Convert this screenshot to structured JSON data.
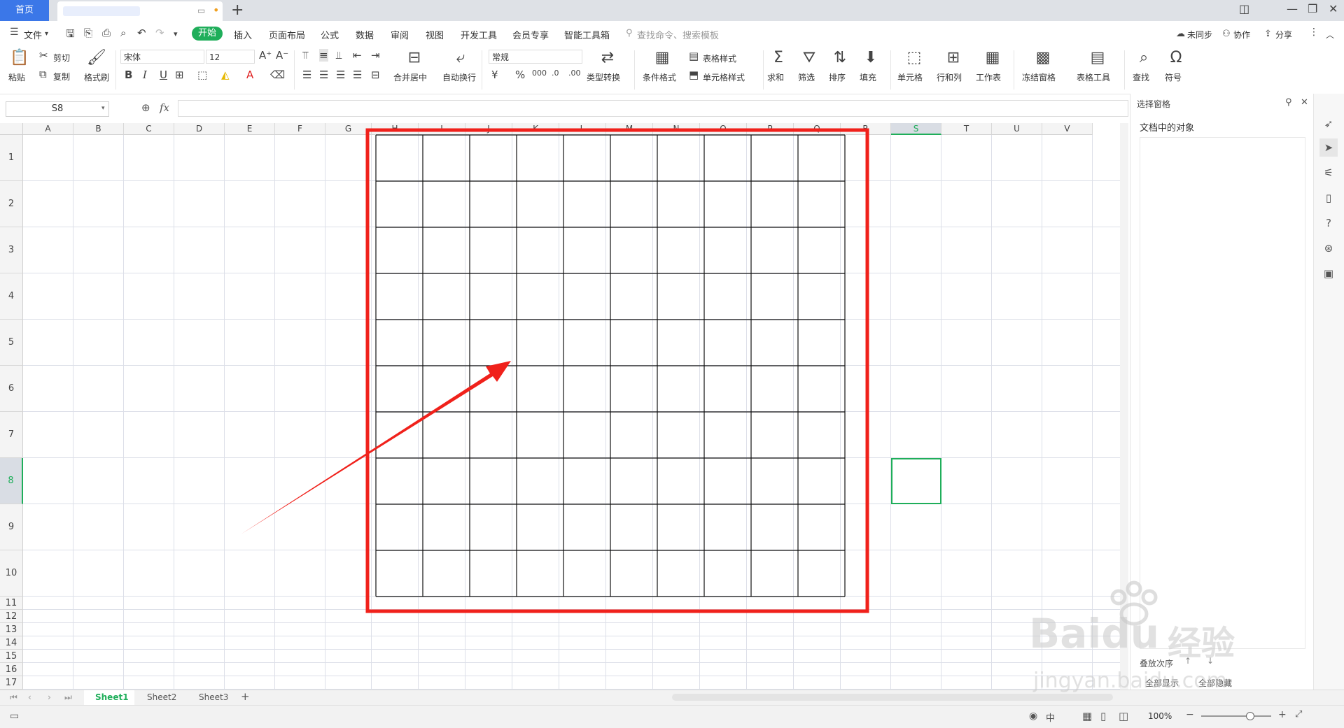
{
  "tabs": {
    "home": "首页"
  },
  "menu": {
    "file": "文件",
    "items": [
      "开始",
      "插入",
      "页面布局",
      "公式",
      "数据",
      "审阅",
      "视图",
      "开发工具",
      "会员专享",
      "智能工具箱"
    ],
    "search": "查找命令、搜索模板",
    "sync": "未同步",
    "collab": "协作",
    "share": "分享"
  },
  "ribbon": {
    "paste": "粘贴",
    "cut": "剪切",
    "copy": "复制",
    "format_painter": "格式刷",
    "font_name": "宋体",
    "font_size": "12",
    "merge_center": "合并居中",
    "wrap_text": "自动换行",
    "number_format": "常规",
    "type_convert": "类型转换",
    "conditional_format": "条件格式",
    "table_style": "表格样式",
    "cell_style": "单元格样式",
    "sum": "求和",
    "filter": "筛选",
    "sort": "排序",
    "fill": "填充",
    "cell": "单元格",
    "row_col": "行和列",
    "worksheet": "工作表",
    "freeze": "冻结窗格",
    "table_tools": "表格工具",
    "find": "查找",
    "symbol": "符号"
  },
  "formula_bar": {
    "name_box": "S8",
    "fx": "fx"
  },
  "grid": {
    "columns": [
      "A",
      "B",
      "C",
      "D",
      "E",
      "F",
      "G",
      "H",
      "I",
      "J",
      "K",
      "L",
      "M",
      "N",
      "O",
      "P",
      "Q",
      "R",
      "S",
      "T",
      "U",
      "V"
    ],
    "rows": [
      "1",
      "2",
      "3",
      "4",
      "5",
      "6",
      "7",
      "8",
      "9",
      "10",
      "11",
      "12",
      "13",
      "14",
      "15",
      "16",
      "17"
    ],
    "selected_cell": "S8"
  },
  "right_panel": {
    "title": "选择窗格",
    "subtitle": "文档中的对象",
    "order": "叠放次序",
    "show_all": "全部显示",
    "hide_all": "全部隐藏"
  },
  "sheets": [
    "Sheet1",
    "Sheet2",
    "Sheet3"
  ],
  "status": {
    "zoom": "100%",
    "ime": "中"
  },
  "watermark": {
    "brand": "Baidu",
    "brand_cn": "经验",
    "url": "jingyan.baidu.com"
  },
  "colors": {
    "accent": "#1fae5a",
    "highlight": "#f0211b",
    "tab_active": "#3b77e8"
  }
}
